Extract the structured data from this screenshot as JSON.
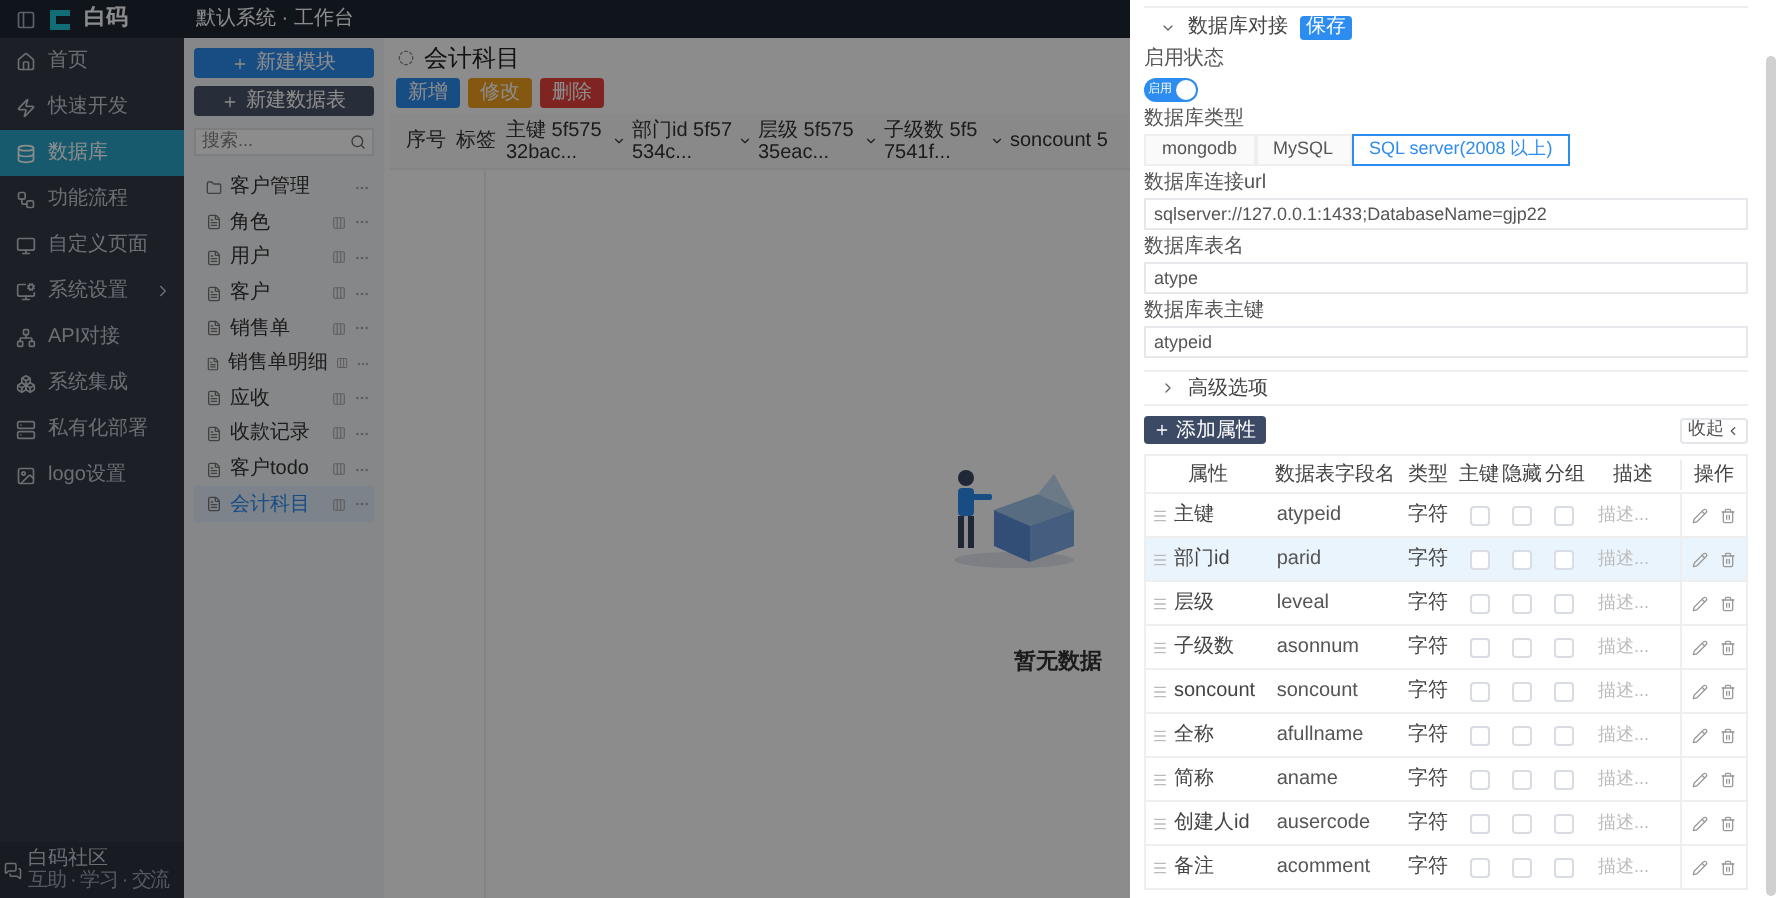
{
  "top_bar": {
    "logo_text": "白码",
    "workspace": "默认系统 · 工作台"
  },
  "sidebar": {
    "items": [
      {
        "label": "首页",
        "selected": false,
        "has_submenu": false
      },
      {
        "label": "快速开发",
        "selected": false,
        "has_submenu": false
      },
      {
        "label": "数据库",
        "selected": true,
        "has_submenu": false
      },
      {
        "label": "功能流程",
        "selected": false,
        "has_submenu": false
      },
      {
        "label": "自定义页面",
        "selected": false,
        "has_submenu": false
      },
      {
        "label": "系统设置",
        "selected": false,
        "has_submenu": true
      },
      {
        "label": "API对接",
        "selected": false,
        "has_submenu": false
      },
      {
        "label": "系统集成",
        "selected": false,
        "has_submenu": false
      },
      {
        "label": "私有化部署",
        "selected": false,
        "has_submenu": false
      },
      {
        "label": "logo设置",
        "selected": false,
        "has_submenu": false
      }
    ],
    "footer": {
      "title": "白码社区",
      "subtitle": "互助 · 学习 · 交流"
    }
  },
  "module_panel": {
    "buttons": [
      {
        "label": "新建模块",
        "kind": "primary"
      },
      {
        "label": "新建数据表",
        "kind": "dark"
      }
    ],
    "search": {
      "placeholder": "搜索..."
    },
    "tree": [
      {
        "label": "客户管理",
        "kind": "folder",
        "selected": false
      },
      {
        "label": "角色",
        "kind": "table",
        "selected": false
      },
      {
        "label": "用户",
        "kind": "table",
        "selected": false
      },
      {
        "label": "客户",
        "kind": "table",
        "selected": false
      },
      {
        "label": "销售单",
        "kind": "table",
        "selected": false
      },
      {
        "label": "销售单明细",
        "kind": "table",
        "selected": false
      },
      {
        "label": "应收",
        "kind": "table",
        "selected": false
      },
      {
        "label": "收款记录",
        "kind": "table",
        "selected": false
      },
      {
        "label": "客户todo",
        "kind": "table",
        "selected": false
      },
      {
        "label": "会计科目",
        "kind": "table",
        "selected": true
      }
    ]
  },
  "content": {
    "title": "会计科目",
    "buttons": [
      {
        "label": "新增",
        "kind": "primary"
      },
      {
        "label": "修改",
        "kind": "warning"
      },
      {
        "label": "删除",
        "kind": "danger"
      }
    ],
    "columns": [
      {
        "label": "序号",
        "dropdown": false
      },
      {
        "label": "标签",
        "dropdown": false
      },
      {
        "label": "主键 5f57532bac...",
        "dropdown": true
      },
      {
        "label": "部门id 5f57534c...",
        "dropdown": true
      },
      {
        "label": "层级 5f57535eac...",
        "dropdown": true
      },
      {
        "label": "子级数 5f57541f...",
        "dropdown": true
      },
      {
        "label": "soncount 5",
        "dropdown": false
      }
    ],
    "empty_text": "暂无数据"
  },
  "drawer": {
    "db_section": {
      "title": "数据库对接",
      "expanded": true,
      "save_button": "保存",
      "enabled_label": "启用状态",
      "enabled": {
        "label": "启用",
        "on": true
      },
      "type_label": "数据库类型",
      "types": [
        {
          "label": "mongodb",
          "selected": false
        },
        {
          "label": "MySQL",
          "selected": false
        },
        {
          "label": "SQL server(2008 以上)",
          "selected": true
        }
      ],
      "fields": [
        {
          "label": "数据库连接url",
          "value": "sqlserver://127.0.0.1:1433;DatabaseName=gjp22"
        },
        {
          "label": "数据库表名",
          "value": "atype"
        },
        {
          "label": "数据库表主键",
          "value": "atypeid"
        }
      ]
    },
    "advanced": {
      "title": "高级选项",
      "expanded": false
    },
    "add_button": "添加属性",
    "collapse_button": "收起",
    "table": {
      "columns": [
        "属性",
        "数据表字段名",
        "类型",
        "主键",
        "隐藏",
        "分组",
        "描述",
        "操作"
      ],
      "rows": [
        {
          "name": "主键",
          "field": "atypeid",
          "type": "字符",
          "primary_key": false,
          "hidden": false,
          "group": false,
          "description": "描述...",
          "selected": false
        },
        {
          "name": "部门id",
          "field": "parid",
          "type": "字符",
          "primary_key": false,
          "hidden": false,
          "group": false,
          "description": "描述...",
          "selected": true
        },
        {
          "name": "层级",
          "field": "leveal",
          "type": "字符",
          "primary_key": false,
          "hidden": false,
          "group": false,
          "description": "描述...",
          "selected": false
        },
        {
          "name": "子级数",
          "field": "asonnum",
          "type": "字符",
          "primary_key": false,
          "hidden": false,
          "group": false,
          "description": "描述...",
          "selected": false
        },
        {
          "name": "soncount",
          "field": "soncount",
          "type": "字符",
          "primary_key": false,
          "hidden": false,
          "group": false,
          "description": "描述...",
          "selected": false
        },
        {
          "name": "全称",
          "field": "afullname",
          "type": "字符",
          "primary_key": false,
          "hidden": false,
          "group": false,
          "description": "描述...",
          "selected": false
        },
        {
          "name": "简称",
          "field": "aname",
          "type": "字符",
          "primary_key": false,
          "hidden": false,
          "group": false,
          "description": "描述...",
          "selected": false
        },
        {
          "name": "创建人id",
          "field": "ausercode",
          "type": "字符",
          "primary_key": false,
          "hidden": false,
          "group": false,
          "description": "描述...",
          "selected": false
        },
        {
          "name": "备注",
          "field": "acomment",
          "type": "字符",
          "primary_key": false,
          "hidden": false,
          "group": false,
          "description": "描述...",
          "selected": false
        }
      ]
    }
  }
}
